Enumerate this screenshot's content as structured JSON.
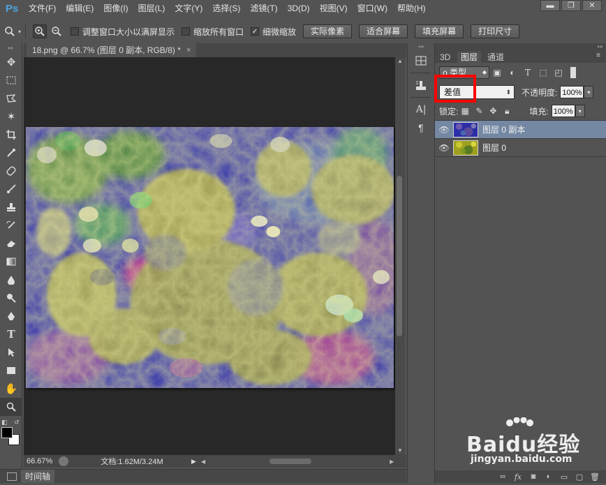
{
  "app": {
    "logo": "Ps"
  },
  "menu": [
    "文件(F)",
    "编辑(E)",
    "图像(I)",
    "图层(L)",
    "文字(Y)",
    "选择(S)",
    "滤镜(T)",
    "3D(D)",
    "视图(V)",
    "窗口(W)",
    "帮助(H)"
  ],
  "window_controls": {
    "minimize": "▬",
    "restore": "❐",
    "close": "✕"
  },
  "options_bar": {
    "check_resize": "调整窗口大小以满屏显示",
    "check_zoom_all": "缩放所有窗口",
    "check_scrubby": "细微缩放",
    "btn_actual": "实际像素",
    "btn_fit": "适合屏幕",
    "btn_fill": "填充屏幕",
    "btn_print": "打印尺寸"
  },
  "document": {
    "tab_title": "18.png @ 66.7% (图层 0 副本, RGB/8) *",
    "tab_close": "×"
  },
  "status": {
    "zoom": "66.67%",
    "doc_info": "文档:1.62M/3.24M"
  },
  "timeline": {
    "label": "时间轴"
  },
  "layers_panel": {
    "tabs": [
      "3D",
      "图层",
      "通道"
    ],
    "filter_label": "ρ 类型",
    "blend_mode": "差值",
    "opacity_label": "不透明度:",
    "opacity_value": "100%",
    "lock_label": "锁定:",
    "fill_label": "填充:",
    "fill_value": "100%",
    "layers": [
      {
        "name": "图层 0 副本",
        "selected": true
      },
      {
        "name": "图层 0",
        "selected": false
      }
    ],
    "footer_fx": "fx"
  },
  "watermark": {
    "brand": "Baidu经验",
    "url": "jingyan.baidu.com"
  },
  "colors": {
    "highlight": "#ff0000",
    "selected_layer": "#7488a3",
    "canvas_bg": "#282828"
  }
}
